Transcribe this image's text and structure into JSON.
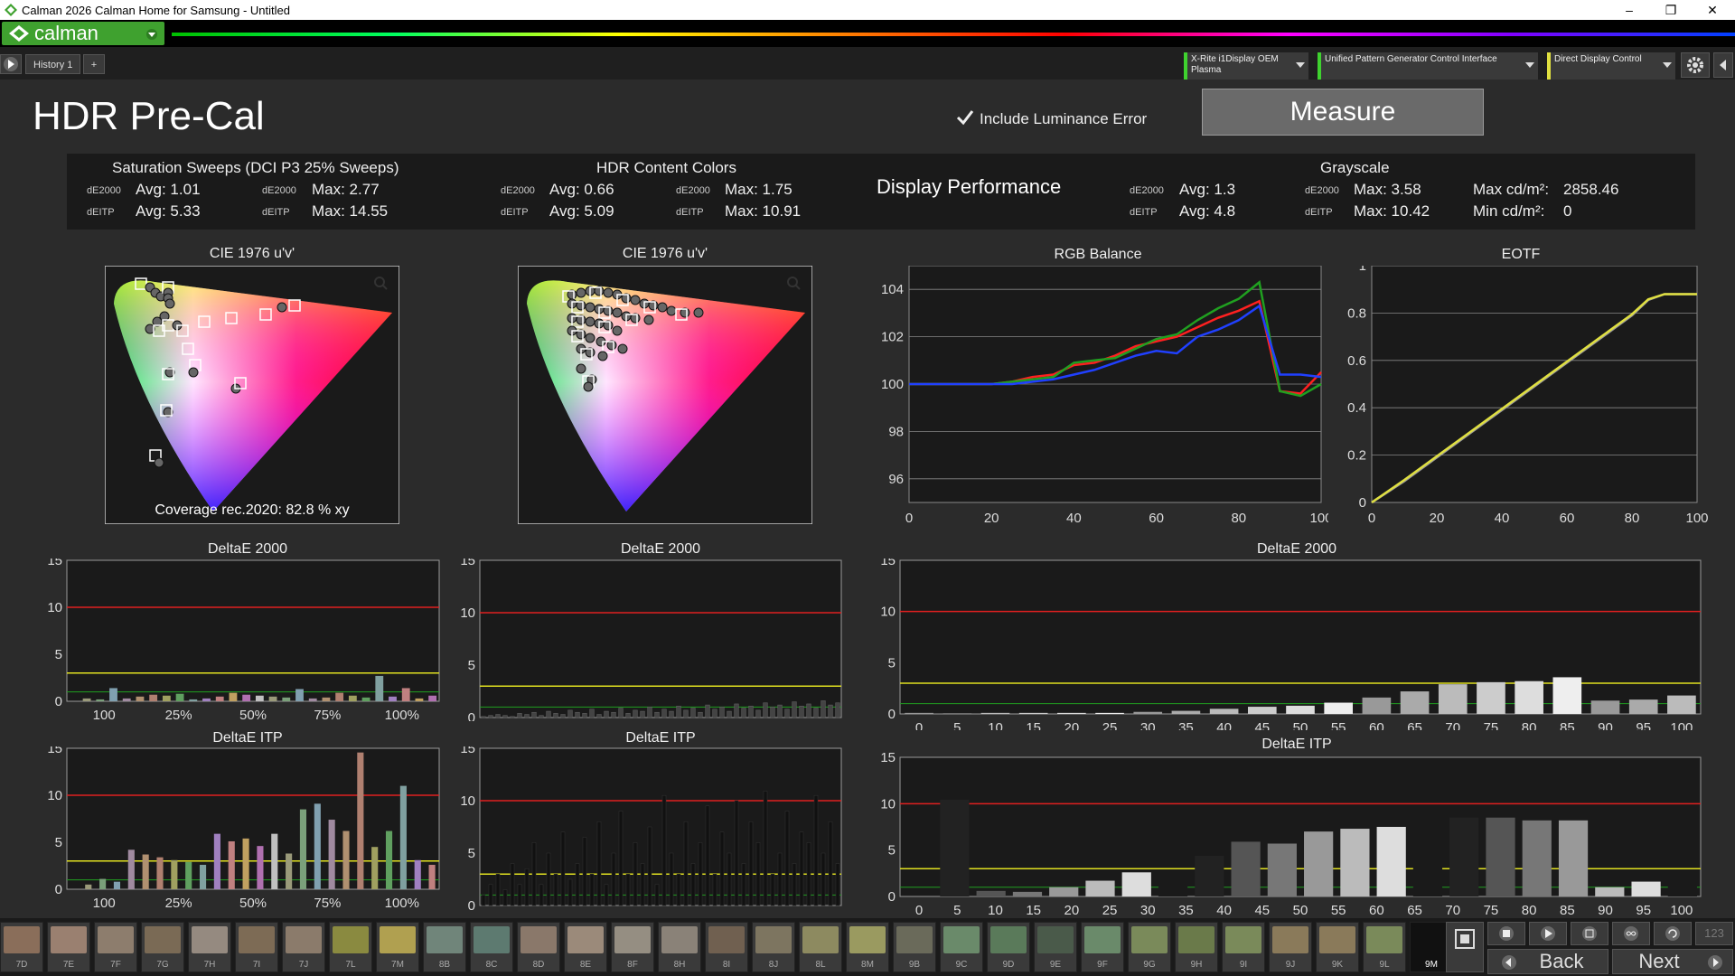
{
  "window": {
    "title": "Calman 2026 Calman Home for Samsung  - Untitled",
    "min_icon": "minimize-icon",
    "max_icon": "maximize-icon",
    "close_icon": "close-icon"
  },
  "app": {
    "logo": "calman"
  },
  "tabs": {
    "history": "History 1",
    "add": "+"
  },
  "devices": [
    {
      "label": "X-Rite i1Display OEM Plasma"
    },
    {
      "label": "Unified Pattern Generator Control Interface"
    },
    {
      "label": "Direct Display Control"
    }
  ],
  "page": {
    "title": "HDR Pre-Cal",
    "include_luminance": "Include Luminance Error",
    "measure": "Measure"
  },
  "summary": {
    "sat": {
      "title": "Saturation Sweeps (DCI P3 25% Sweeps)",
      "de2000": "dE2000",
      "deitp": "dEITP",
      "avg2000": "Avg: 1.01",
      "max2000": "Max: 2.77",
      "avgitp": "Avg: 5.33",
      "maxitp": "Max: 14.55"
    },
    "hdr": {
      "title": "HDR Content Colors",
      "de2000": "dE2000",
      "deitp": "dEITP",
      "avg2000": "Avg: 0.66",
      "max2000": "Max: 1.75",
      "avgitp": "Avg: 5.09",
      "maxitp": "Max: 10.91"
    },
    "display_performance": "Display Performance",
    "gray": {
      "title": "Grayscale",
      "de2000": "dE2000",
      "deitp": "dEITP",
      "avg2000": "Avg: 1.3",
      "max2000": "Max: 3.58",
      "avgitp": "Avg: 4.8",
      "maxitp": "Max: 10.42",
      "maxcd": "Max cd/m²:",
      "maxcd_val": "2858.46",
      "mincd": "Min cd/m²:",
      "mincd_val": "0"
    }
  },
  "cie1": {
    "title": "CIE 1976 u'v'",
    "coverage": "Coverage rec.2020:  82.8 % xy"
  },
  "cie2": {
    "title": "CIE 1976 u'v'"
  },
  "chart_data": [
    {
      "type": "line",
      "title": "RGB Balance",
      "x": [
        0,
        5,
        10,
        15,
        20,
        25,
        30,
        35,
        40,
        45,
        50,
        55,
        60,
        65,
        70,
        75,
        80,
        85,
        90,
        95,
        100
      ],
      "xlim": [
        0,
        100
      ],
      "ylim": [
        95,
        105
      ],
      "series": [
        {
          "color": "#ff2020",
          "values": [
            100,
            100,
            100,
            100,
            100,
            100.1,
            100.3,
            100.4,
            100.8,
            100.9,
            101.2,
            101.6,
            101.8,
            102,
            102.4,
            102.8,
            103.1,
            103.5,
            99.7,
            99.6,
            100.5
          ]
        },
        {
          "color": "#20a020",
          "values": [
            100,
            100,
            100,
            100,
            100,
            100.1,
            100.2,
            100.3,
            100.9,
            101,
            101.1,
            101.5,
            101.9,
            102.1,
            102.7,
            103.2,
            103.6,
            104.3,
            99.7,
            99.5,
            100
          ]
        },
        {
          "color": "#2040ff",
          "values": [
            100,
            100,
            100,
            100,
            100,
            100,
            100.1,
            100.2,
            100.4,
            100.6,
            100.9,
            101.2,
            101.4,
            101.3,
            102,
            102.3,
            102.7,
            103.3,
            100.4,
            100.4,
            100.3
          ]
        }
      ]
    },
    {
      "type": "line",
      "title": "EOTF",
      "x": [
        0,
        10,
        20,
        30,
        40,
        50,
        60,
        70,
        80,
        85,
        90,
        95,
        100
      ],
      "xlim": [
        0,
        100
      ],
      "ylim": [
        0,
        1
      ],
      "series": [
        {
          "color": "#9a9a9a",
          "values": [
            0,
            0.09,
            0.19,
            0.29,
            0.39,
            0.49,
            0.59,
            0.69,
            0.79,
            0.855,
            0.88,
            0.88,
            0.88
          ]
        },
        {
          "color": "#e0e040",
          "values": [
            0,
            0.095,
            0.195,
            0.295,
            0.395,
            0.495,
            0.595,
            0.695,
            0.795,
            0.858,
            0.88,
            0.88,
            0.88
          ]
        }
      ]
    },
    {
      "type": "bar",
      "title": "DeltaE 2000",
      "ylim": [
        0,
        15
      ],
      "ticks": [
        "100",
        "25%",
        "50%",
        "75%",
        "100%"
      ],
      "values": [
        0,
        0.3,
        0.2,
        1.4,
        0.3,
        0.5,
        0.7,
        0.6,
        0.8,
        0.2,
        0.3,
        0.5,
        0.9,
        0.7,
        0.6,
        0.5,
        0.4,
        1.3,
        0.3,
        0.4,
        0.9,
        0.6,
        0.4,
        2.7,
        0.5,
        1.4,
        0.3,
        0.6
      ]
    },
    {
      "type": "bar",
      "title": "DeltaE 2000",
      "ylim": [
        0,
        15
      ],
      "values": [
        0.1,
        0.2,
        0.3,
        0.2,
        0.1,
        0.4,
        0.3,
        0.5,
        0.2,
        0.6,
        0.4,
        0.3,
        0.7,
        0.5,
        0.4,
        0.8,
        0.3,
        0.6,
        0.5,
        0.9,
        0.4,
        0.7,
        0.6,
        1.0,
        0.5,
        0.8,
        0.6,
        1.1,
        0.7,
        0.9,
        0.5,
        1.2,
        0.8,
        1.0,
        0.6,
        1.3,
        0.9,
        1.1,
        0.7,
        1.4,
        1.0,
        1.2,
        0.8,
        1.5,
        1.1,
        1.3,
        0.9,
        1.6,
        1.2,
        1.4
      ]
    },
    {
      "type": "bar",
      "title": "DeltaE 2000",
      "ylim": [
        0,
        15
      ],
      "categories": [
        "0",
        "5",
        "10",
        "15",
        "20",
        "25",
        "30",
        "35",
        "40",
        "45",
        "50",
        "55",
        "60",
        "65",
        "70",
        "75",
        "80",
        "85",
        "90",
        "95",
        "100"
      ],
      "values": [
        0.1,
        0.05,
        0.1,
        0.1,
        0.1,
        0.1,
        0.2,
        0.3,
        0.5,
        0.7,
        0.8,
        1.1,
        1.6,
        2.2,
        2.9,
        3.1,
        3.2,
        3.58,
        1.3,
        1.4,
        1.8
      ]
    },
    {
      "type": "bar",
      "title": "DeltaE ITP",
      "ylim": [
        0,
        15
      ],
      "ticks": [
        "100",
        "25%",
        "50%",
        "75%",
        "100%"
      ],
      "values": [
        0,
        0.5,
        1.1,
        0.8,
        4.2,
        3.7,
        3.4,
        3.1,
        2.9,
        2.6,
        5.9,
        5.1,
        5.4,
        4.6,
        5.9,
        3.8,
        8.5,
        9.1,
        7.4,
        6.2,
        14.55,
        4.5,
        6.2,
        11,
        3.1,
        2.6
      ]
    },
    {
      "type": "bar",
      "title": "DeltaE ITP",
      "ylim": [
        0,
        15
      ],
      "values": [
        1,
        2,
        3,
        1.5,
        4,
        2,
        3.5,
        6,
        2,
        5,
        3,
        7,
        2.5,
        4,
        6.5,
        3,
        8,
        2,
        5,
        9,
        3,
        6,
        4,
        7.5,
        2,
        10.5,
        5,
        3,
        8,
        4,
        6,
        9.5,
        3,
        7,
        5,
        10,
        4,
        8,
        6,
        10.91,
        3,
        5,
        9,
        4,
        7,
        6,
        10.5,
        5,
        8,
        4
      ]
    },
    {
      "type": "bar",
      "title": "DeltaE ITP",
      "ylim": [
        0,
        15
      ],
      "categories": [
        "0",
        "5",
        "10",
        "15",
        "20",
        "25",
        "30",
        "35",
        "40",
        "45",
        "50",
        "55",
        "60",
        "65",
        "70",
        "75",
        "80",
        "85",
        "90",
        "95",
        "100"
      ],
      "values": [
        0,
        10.42,
        0.6,
        0.5,
        1.0,
        1.7,
        2.6,
        2.8,
        4.4,
        5.9,
        5.7,
        7.0,
        7.3,
        7.5,
        7.7,
        8.5,
        8.5,
        8.2,
        8.2,
        1.0,
        1.6,
        1.2
      ]
    }
  ],
  "swatches": [
    "7D",
    "7E",
    "7F",
    "7G",
    "7H",
    "7I",
    "7J",
    "7L",
    "7M",
    "8B",
    "8C",
    "8D",
    "8E",
    "8F",
    "8H",
    "8I",
    "8J",
    "8L",
    "8M",
    "9B",
    "9C",
    "9D",
    "9E",
    "9F",
    "9G",
    "9H",
    "9I",
    "9J",
    "9K",
    "9L",
    "9M"
  ],
  "swatch_colors": [
    "#8a6e5a",
    "#9a8070",
    "#8d7d6d",
    "#7a6a55",
    "#958a80",
    "#7d6b55",
    "#8b7b6b",
    "#8a8a40",
    "#b0a050",
    "#70857a",
    "#5d7a70",
    "#8a786a",
    "#9b8a7a",
    "#958e82",
    "#8a8278",
    "#706050",
    "#7d7560",
    "#8d8a60",
    "#9a9a60",
    "#6a6a5a",
    "#6a8a6a",
    "#5a7a5a",
    "#4a5a4a",
    "#6a8a6a",
    "#7a8a5a",
    "#6a7a4a",
    "#7a8a5a",
    "#8a7a5a",
    "#8a7a5a",
    "#7a8a5a",
    "#111111"
  ],
  "nav": {
    "back": "Back",
    "next": "Next",
    "num": "123"
  }
}
